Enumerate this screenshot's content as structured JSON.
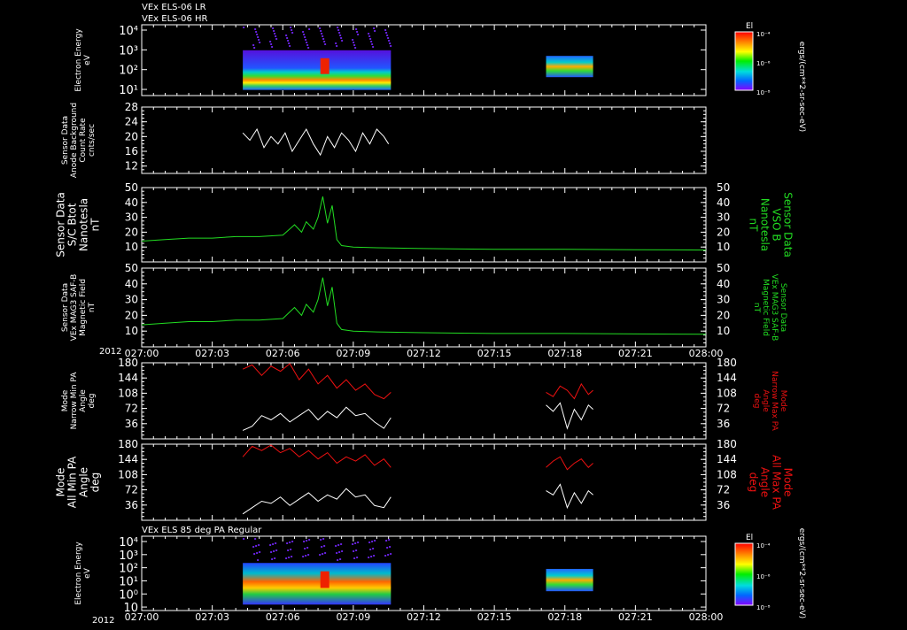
{
  "header": {
    "lines": [
      "VEx ELS-06 LR",
      "VEx ELS-06 HR"
    ]
  },
  "footer_year": [
    "2012",
    "2012"
  ],
  "time_axis": {
    "ticks": [
      "027:00",
      "027:03",
      "027:06",
      "027:09",
      "027:12",
      "027:15",
      "027:18",
      "027:21",
      "028:00"
    ],
    "tick_minutes": [
      0,
      3,
      6,
      9,
      12,
      15,
      18,
      21,
      24
    ],
    "range_minutes": [
      0,
      24
    ]
  },
  "colors": {
    "background": "#000000",
    "axes": "#ffffff",
    "green": "#22dd22",
    "red": "#ee1111",
    "white": "#ffffff"
  },
  "colorbars": [
    {
      "label": "El",
      "ticks": [
        "10⁻⁴",
        "10⁻⁶",
        "10⁻⁸"
      ],
      "unit": "ergs/(cm**2-sr-sec-eV)"
    },
    {
      "label": "El",
      "ticks": [
        "10⁻⁴",
        "10⁻⁶",
        "10⁻⁸"
      ],
      "unit": "ergs/(cm**2-sr-sec-eV)"
    }
  ],
  "chart_data": [
    {
      "type": "heatmap",
      "panel": "electron-energy-1",
      "ylabel": [
        "Electron Energy",
        "eV"
      ],
      "y_ticks": [
        "10⁴",
        "10³",
        "10²",
        "10¹"
      ],
      "y_scale": "log",
      "intervals_minutes": [
        [
          4.3,
          10.6
        ],
        [
          17.2,
          19.2
        ]
      ]
    },
    {
      "type": "line",
      "panel": "anode-background",
      "ylabel": [
        "Sensor Data",
        "Anode Background",
        "Count Rate",
        "cnts/sec"
      ],
      "ylim": [
        10,
        28
      ],
      "y_ticks": [
        12,
        16,
        20,
        24,
        28
      ],
      "series": [
        {
          "color": "white",
          "x": [
            4.3,
            4.6,
            4.9,
            5.2,
            5.5,
            5.8,
            6.1,
            6.4,
            6.7,
            7.0,
            7.3,
            7.6,
            7.9,
            8.2,
            8.5,
            8.8,
            9.1,
            9.4,
            9.7,
            10.0,
            10.3,
            10.5
          ],
          "y": [
            21,
            19,
            22,
            17,
            20,
            18,
            21,
            16,
            19,
            22,
            18,
            15,
            20,
            17,
            21,
            19,
            16,
            21,
            18,
            22,
            20,
            18
          ]
        }
      ]
    },
    {
      "type": "line",
      "panel": "sc-bmag",
      "ylabel": [
        "Sensor Data",
        "S/C Btot",
        "Nanotesla",
        "nT"
      ],
      "right_label": [
        "Sensor Data",
        "VSO B",
        "Nanotesla",
        "nT"
      ],
      "ylim": [
        0,
        50
      ],
      "y_ticks": [
        10,
        20,
        30,
        40,
        50
      ],
      "series": [
        {
          "color": "green",
          "x": [
            0,
            1,
            2,
            3,
            4,
            5,
            6,
            6.5,
            6.8,
            7.0,
            7.3,
            7.5,
            7.7,
            7.9,
            8.1,
            8.3,
            8.5,
            9,
            10,
            12,
            15,
            18,
            21,
            24
          ],
          "y": [
            14,
            15,
            16,
            16,
            17,
            17,
            18,
            25,
            20,
            27,
            22,
            30,
            44,
            26,
            38,
            15,
            11,
            10,
            9.5,
            9,
            8.5,
            8.5,
            8.2,
            8
          ]
        }
      ]
    },
    {
      "type": "line",
      "panel": "mag-field",
      "ylabel": [
        "Sensor Data",
        "VEx MAG3 SAF-B",
        "Magnetic Field",
        "nT"
      ],
      "right_label": [
        "Sensor Data",
        "VEx MAG3 SAF-B",
        "Magnetic Field",
        "nT"
      ],
      "ylim": [
        0,
        50
      ],
      "y_ticks": [
        10,
        20,
        30,
        40,
        50
      ],
      "series": [
        {
          "color": "green",
          "x": [
            0,
            1,
            2,
            3,
            4,
            5,
            6,
            6.5,
            6.8,
            7.0,
            7.3,
            7.5,
            7.7,
            7.9,
            8.1,
            8.3,
            8.5,
            9,
            10,
            12,
            15,
            18,
            21,
            24
          ],
          "y": [
            14,
            15,
            16,
            16,
            17,
            17,
            18,
            25,
            20,
            27,
            22,
            30,
            44,
            26,
            38,
            15,
            11,
            10,
            9.5,
            9,
            8.5,
            8.5,
            8.2,
            8
          ]
        }
      ]
    },
    {
      "type": "line",
      "panel": "narrow-pa",
      "ylabel": [
        "Mode",
        "Narrow Min PA",
        "Angle",
        "deg"
      ],
      "right_label": [
        "Mode",
        "Narrow Max PA",
        "Angle",
        "deg"
      ],
      "ylim": [
        0,
        180
      ],
      "y_ticks": [
        36,
        72,
        108,
        144,
        180
      ],
      "series": [
        {
          "color": "red",
          "x": [
            4.3,
            4.7,
            5.1,
            5.5,
            5.9,
            6.3,
            6.7,
            7.1,
            7.5,
            7.9,
            8.3,
            8.7,
            9.1,
            9.5,
            9.9,
            10.3,
            10.6
          ],
          "y": [
            165,
            175,
            150,
            172,
            160,
            178,
            140,
            165,
            130,
            150,
            120,
            140,
            115,
            130,
            105,
            95,
            110
          ]
        },
        {
          "color": "white",
          "x": [
            4.3,
            4.7,
            5.1,
            5.5,
            5.9,
            6.3,
            6.7,
            7.1,
            7.5,
            7.9,
            8.3,
            8.7,
            9.1,
            9.5,
            9.9,
            10.3,
            10.6
          ],
          "y": [
            20,
            30,
            55,
            45,
            60,
            40,
            55,
            70,
            45,
            65,
            50,
            75,
            55,
            60,
            40,
            25,
            50
          ]
        },
        {
          "color": "red",
          "x": [
            17.2,
            17.5,
            17.8,
            18.1,
            18.4,
            18.7,
            19.0,
            19.2
          ],
          "y": [
            110,
            100,
            125,
            115,
            95,
            130,
            105,
            115
          ]
        },
        {
          "color": "white",
          "x": [
            17.2,
            17.5,
            17.8,
            18.1,
            18.4,
            18.7,
            19.0,
            19.2
          ],
          "y": [
            80,
            65,
            85,
            25,
            70,
            45,
            80,
            70
          ]
        }
      ]
    },
    {
      "type": "line",
      "panel": "all-pa",
      "ylabel": [
        "Mode",
        "All Min PA",
        "Angle",
        "deg"
      ],
      "right_label": [
        "Mode",
        "All Max PA",
        "Angle",
        "deg"
      ],
      "ylim": [
        0,
        180
      ],
      "y_ticks": [
        36,
        72,
        108,
        144,
        180
      ],
      "series": [
        {
          "color": "red",
          "x": [
            4.3,
            4.7,
            5.1,
            5.5,
            5.9,
            6.3,
            6.7,
            7.1,
            7.5,
            7.9,
            8.3,
            8.7,
            9.1,
            9.5,
            9.9,
            10.3,
            10.6
          ],
          "y": [
            150,
            175,
            165,
            178,
            160,
            170,
            150,
            165,
            145,
            160,
            135,
            150,
            140,
            155,
            130,
            145,
            125
          ]
        },
        {
          "color": "white",
          "x": [
            4.3,
            4.7,
            5.1,
            5.5,
            5.9,
            6.3,
            6.7,
            7.1,
            7.5,
            7.9,
            8.3,
            8.7,
            9.1,
            9.5,
            9.9,
            10.3,
            10.6
          ],
          "y": [
            15,
            30,
            45,
            40,
            55,
            35,
            50,
            65,
            45,
            60,
            50,
            75,
            55,
            60,
            35,
            30,
            55
          ]
        },
        {
          "color": "red",
          "x": [
            17.2,
            17.5,
            17.8,
            18.1,
            18.4,
            18.7,
            19.0,
            19.2
          ],
          "y": [
            125,
            140,
            150,
            120,
            135,
            145,
            125,
            135
          ]
        },
        {
          "color": "white",
          "x": [
            17.2,
            17.5,
            17.8,
            18.1,
            18.4,
            18.7,
            19.0,
            19.2
          ],
          "y": [
            70,
            60,
            85,
            30,
            65,
            40,
            70,
            60
          ]
        }
      ]
    },
    {
      "type": "heatmap",
      "panel": "electron-energy-2",
      "title": "VEx ELS 85 deg PA Regular",
      "ylabel": [
        "Electron Energy",
        "eV"
      ],
      "y_ticks": [
        "10⁴",
        "10³",
        "10²",
        "10¹",
        "10⁰",
        "10"
      ],
      "y_scale": "log",
      "intervals_minutes": [
        [
          4.3,
          10.6
        ],
        [
          17.2,
          19.2
        ]
      ]
    }
  ]
}
